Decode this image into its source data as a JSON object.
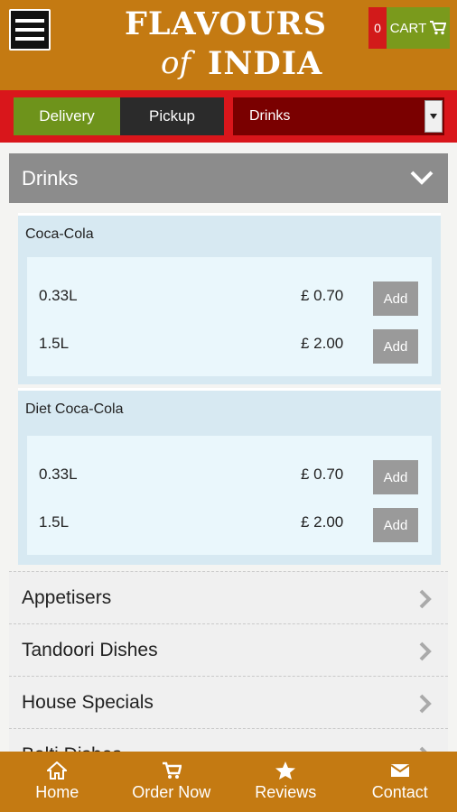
{
  "header": {
    "logo_top": "FLAVOURS",
    "logo_of": "of",
    "logo_bottom": "INDIA",
    "cart_count": "0",
    "cart_label": "CART"
  },
  "order_bar": {
    "delivery_label": "Delivery",
    "pickup_label": "Pickup",
    "category_select_value": "Drinks"
  },
  "section": {
    "title": "Drinks"
  },
  "items": [
    {
      "name": "Coca-Cola",
      "options": [
        {
          "size": "0.33L",
          "price": "£ 0.70",
          "add_label": "Add"
        },
        {
          "size": "1.5L",
          "price": "£ 2.00",
          "add_label": "Add"
        }
      ]
    },
    {
      "name": "Diet Coca-Cola",
      "options": [
        {
          "size": "0.33L",
          "price": "£ 0.70",
          "add_label": "Add"
        },
        {
          "size": "1.5L",
          "price": "£ 2.00",
          "add_label": "Add"
        }
      ]
    }
  ],
  "categories": [
    {
      "label": "Appetisers"
    },
    {
      "label": "Tandoori Dishes"
    },
    {
      "label": "House Specials"
    },
    {
      "label": "Balti Dishes"
    }
  ],
  "bottom_nav": [
    {
      "label": "Home",
      "icon": "home-icon"
    },
    {
      "label": "Order Now",
      "icon": "cart-icon"
    },
    {
      "label": "Reviews",
      "icon": "star-icon"
    },
    {
      "label": "Contact",
      "icon": "envelope-icon"
    }
  ],
  "colors": {
    "brand_orange": "#c47a12",
    "red_bar": "#d9161b",
    "delivery_green": "#6e931b",
    "select_dark_red": "#7a0000"
  }
}
